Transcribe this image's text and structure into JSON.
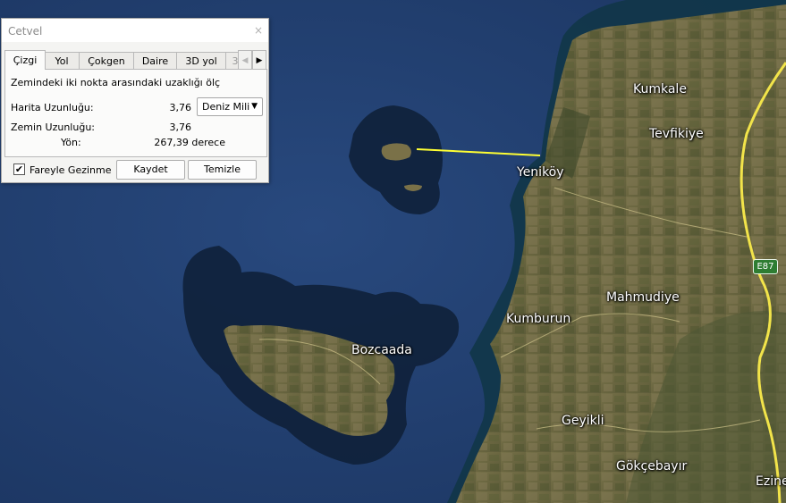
{
  "dialog": {
    "title": "Cetvel",
    "close_glyph": "×",
    "tabs": [
      {
        "label": "Çizgi",
        "active": true
      },
      {
        "label": "Yol"
      },
      {
        "label": "Çokgen"
      },
      {
        "label": "Daire"
      },
      {
        "label": "3D yol"
      },
      {
        "label": "3"
      }
    ],
    "tab_scroll_left": "◀",
    "tab_scroll_right": "▶",
    "description": "Zemindeki iki nokta arasındaki uzaklığı ölç",
    "map_length_label": "Harita Uzunluğu:",
    "map_length_value": "3,76",
    "unit_selected": "Deniz Mili",
    "ground_length_label": "Zemin Uzunluğu:",
    "ground_length_value": "3,76",
    "heading_label": "Yön:",
    "heading_value": "267,39 derece",
    "mouse_nav_checked": true,
    "mouse_nav_label": "Fareyle Gezinme",
    "save_label": "Kaydet",
    "clear_label": "Temizle"
  },
  "map": {
    "places": [
      "Kumkale",
      "Tevfikiye",
      "Yeniköy",
      "Mahmudiye",
      "Kumburun",
      "Bozcaada",
      "Geyikli",
      "Gökçebayır",
      "Ezine"
    ],
    "road_shield": "E87",
    "colors": {
      "sea": "#1e3a6a",
      "land": "#6e6b43",
      "measure_line": "#ffff33",
      "highway": "#f2e44a"
    }
  }
}
